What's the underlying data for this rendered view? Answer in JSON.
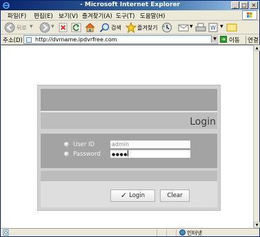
{
  "window": {
    "title": "- Microsoft Internet Explorer"
  },
  "menu": [
    {
      "label": "파일(F)"
    },
    {
      "label": "편집(E)"
    },
    {
      "label": "보기(V)"
    },
    {
      "label": "즐겨찾기(A)"
    },
    {
      "label": "도구(T)"
    },
    {
      "label": "도움말(H)"
    }
  ],
  "toolbar": {
    "back_label": "뒤로",
    "search_label": "검색",
    "favorites_label": "즐겨찾기"
  },
  "address": {
    "label": "주소(D)",
    "url": "http://dvrname.ipdvrfree.com",
    "go_label": "이동",
    "links_label": "연결"
  },
  "login": {
    "title": "Login",
    "userid_label": "User ID",
    "userid_value": "admin",
    "password_label": "Password",
    "password_value": "●●●●",
    "login_button": "Login",
    "clear_button": "Clear"
  },
  "status": {
    "zone": "인터넷"
  },
  "colors": {
    "titlebar": "#0a246a",
    "panel": "#d0d0d0",
    "form_band": "#a3a3a3"
  }
}
